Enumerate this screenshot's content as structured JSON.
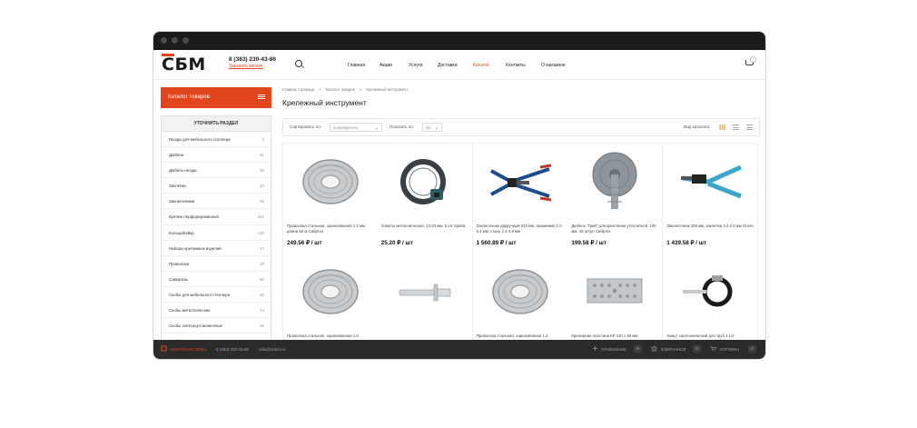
{
  "header": {
    "logo": "СБМ",
    "phone": "8 (383) 230-43-86",
    "callback": "Заказать звонок",
    "nav": [
      "Главная",
      "Акции",
      "Услуги",
      "Доставка",
      "Каталог",
      "Контакты",
      "О магазине"
    ],
    "active_nav": "Каталог"
  },
  "sidebar": {
    "catalog_button": "Каталог товаров",
    "refine_title": "УТОЧНИТЬ РАЗДЕЛ",
    "sections": [
      {
        "name": "Гвозди для мебельного степлера",
        "count": "0"
      },
      {
        "name": "Дюбели",
        "count": "51"
      },
      {
        "name": "Дюбель-гвозди",
        "count": "36"
      },
      {
        "name": "Заклепки",
        "count": "40"
      },
      {
        "name": "Заклепочники",
        "count": "55"
      },
      {
        "name": "Крепеж перфорированный",
        "count": "331"
      },
      {
        "name": "Кольца/Кейкр",
        "count": "130"
      },
      {
        "name": "Наборы крепежных изделий",
        "count": "47"
      },
      {
        "name": "Проволока",
        "count": "28"
      },
      {
        "name": "Саморезы",
        "count": "60"
      },
      {
        "name": "Скобы для мебельного степлера",
        "count": "82"
      },
      {
        "name": "Скобы металлические",
        "count": "14"
      },
      {
        "name": "Скобы электроустановочные",
        "count": "50"
      },
      {
        "name": "Скобяные изделия",
        "count": "156"
      }
    ]
  },
  "main": {
    "breadcrumbs": [
      "Главная страница",
      "»",
      "Каталог товаров",
      "»",
      "Крепежный инструмент"
    ],
    "title": "Крепежный инструмент",
    "sort_label": "Сортировать по:",
    "sort_value": "популярности",
    "show_label": "Показать по:",
    "show_value": "30",
    "view_label": "Вид каталога:"
  },
  "products": [
    {
      "name": "Проволока стальная, оцинкованная 1.2 мм, длина 50 м Сибртех",
      "price": "249.56 ₽ / шт",
      "icon": "wire-coil"
    },
    {
      "name": "Хомуты металлические, 13-23 мм, 5 шт Sparta",
      "price": "25.20 ₽ / шт",
      "icon": "hose-clamp"
    },
    {
      "name": "Заклепочник двуручный 510 мм, алюминий 2.4-6.4 мм, сталь 2.4-4.8 мм",
      "price": "1 560.89 ₽ / шт",
      "icon": "rivet-gun-large"
    },
    {
      "name": "Дюбель \"Гриб\" для крепления утеплителя, 100 мм, 45 шт/уп Сибртех",
      "price": "199.58 ₽ / шт",
      "icon": "insulation-dowel"
    },
    {
      "name": "Заклепочник 259 мм, заклепки 2.4-4.8 мм Gross",
      "price": "1 439.58 ₽ / шт",
      "icon": "rivet-gun"
    },
    {
      "name": "Проволока стальная, оцинкованная 1.5",
      "price": "",
      "icon": "wire-coil"
    },
    {
      "name": "",
      "price": "",
      "icon": "blind-rivet"
    },
    {
      "name": "Проволока стальная, оцинкованная 1.2",
      "price": "",
      "icon": "wire-coil"
    },
    {
      "name": "Крепежная пластина КР 140 х 55 мм",
      "price": "",
      "icon": "perforated-plate"
    },
    {
      "name": "Хомут сантехнический для труб 3 1/2",
      "price": "",
      "icon": "pipe-clamp"
    }
  ],
  "footer": {
    "callback": "ОБРАТНАЯ СВЯЗЬ",
    "phone": "8 (383) 230-43-86",
    "email": "sale@1sbm.ru",
    "compare_label": "СРАВНЕНИЕ",
    "compare_count": "0",
    "favorites_label": "ИЗБРАННОЕ",
    "favorites_count": "0",
    "cart_label": "КОРЗИНА",
    "cart_count": "0"
  },
  "colors": {
    "accent": "#e2461d",
    "titlebar": "#1b1b1b",
    "footer": "#2b2b2b",
    "view_active": "#e8a417"
  }
}
